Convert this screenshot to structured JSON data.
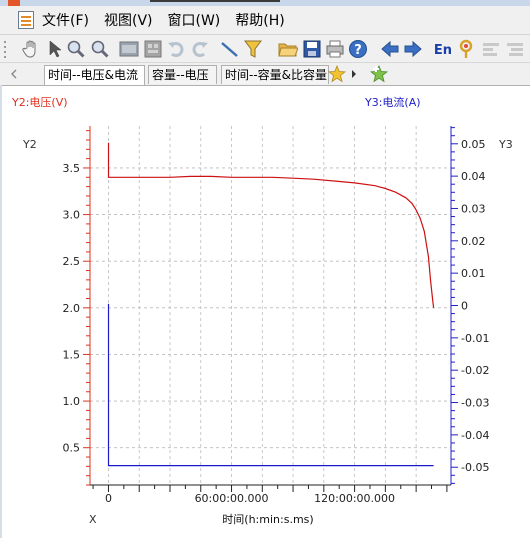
{
  "menu": {
    "items": [
      "文件(F)",
      "视图(V)",
      "窗口(W)",
      "帮助(H)"
    ]
  },
  "toolbar": {
    "icons": [
      "pan-hand-icon",
      "pointer-icon",
      "zoom-in-icon",
      "zoom-out-icon",
      "test-icon",
      "report-icon",
      "undo-icon",
      "redo-icon",
      "draw-line-icon",
      "filter-icon",
      "open-folder-icon",
      "save-icon",
      "print-icon",
      "help-icon",
      "back-arrow-icon",
      "forward-arrow-icon",
      "language-en-icon",
      "settings-icon",
      "align-icon",
      "align-alt-icon"
    ],
    "lang_label": "En"
  },
  "tabs": [
    {
      "label": "时间--电压&电流",
      "active": true
    },
    {
      "label": "容量--电压",
      "active": false
    },
    {
      "label": "时间--容量&比容量",
      "active": false
    }
  ],
  "colors": {
    "voltage": "#cc1111",
    "current": "#1a1acc",
    "grid": "#bbbbbb"
  },
  "chart_data": {
    "type": "line",
    "title": "",
    "xlabel": "时间(h:min:s.ms)",
    "x_axis_letter": "X",
    "y_left_label": "Y2:电压(V)",
    "y_right_label": "Y3:电流(A)",
    "y_left_letter": "Y2",
    "y_right_letter": "Y3",
    "x_unit": "hours",
    "xlim": [
      -9,
      167
    ],
    "x_ticks": [
      0,
      60,
      120
    ],
    "x_tick_labels": [
      "0",
      "60:00:00.000",
      "120:00:00.000"
    ],
    "y_left_lim": [
      0.1,
      3.95
    ],
    "y_left_ticks": [
      0.5,
      1.0,
      1.5,
      2.0,
      2.5,
      3.0,
      3.5
    ],
    "y_left_tick_labels": [
      "0.5",
      "1.0",
      "1.5",
      "2.0",
      "2.5",
      "3.0",
      "3.5"
    ],
    "y_right_lim": [
      -0.0555,
      0.0555
    ],
    "y_right_ticks": [
      0.05,
      0.04,
      0.03,
      0.02,
      0.01,
      0,
      -0.01,
      -0.02,
      -0.03,
      -0.04,
      -0.05
    ],
    "y_right_tick_labels": [
      "0.05",
      "0.04",
      "0.03",
      "0.02",
      "0.01",
      "0",
      "-0.01",
      "-0.02",
      "-0.03",
      "-0.04",
      "-0.05"
    ],
    "grid": true,
    "series": [
      {
        "name": "电压(V)",
        "axis": "left",
        "x": [
          0,
          0,
          0,
          0.5,
          10,
          20,
          30,
          40,
          50,
          60,
          70,
          80,
          90,
          100,
          110,
          120,
          130,
          135,
          140,
          145,
          148,
          150,
          152,
          154,
          156,
          157,
          158,
          158.5
        ],
        "y": [
          3.77,
          3.42,
          3.4,
          3.4,
          3.4,
          3.4,
          3.4,
          3.41,
          3.41,
          3.4,
          3.4,
          3.4,
          3.39,
          3.38,
          3.36,
          3.34,
          3.31,
          3.28,
          3.24,
          3.18,
          3.12,
          3.05,
          2.96,
          2.82,
          2.55,
          2.3,
          2.1,
          2.0
        ]
      },
      {
        "name": "电流(A)",
        "axis": "right",
        "x": [
          0,
          0,
          5,
          100,
          158.5
        ],
        "y": [
          0.0005,
          -0.0495,
          -0.0495,
          -0.0495,
          -0.0495
        ]
      }
    ]
  }
}
